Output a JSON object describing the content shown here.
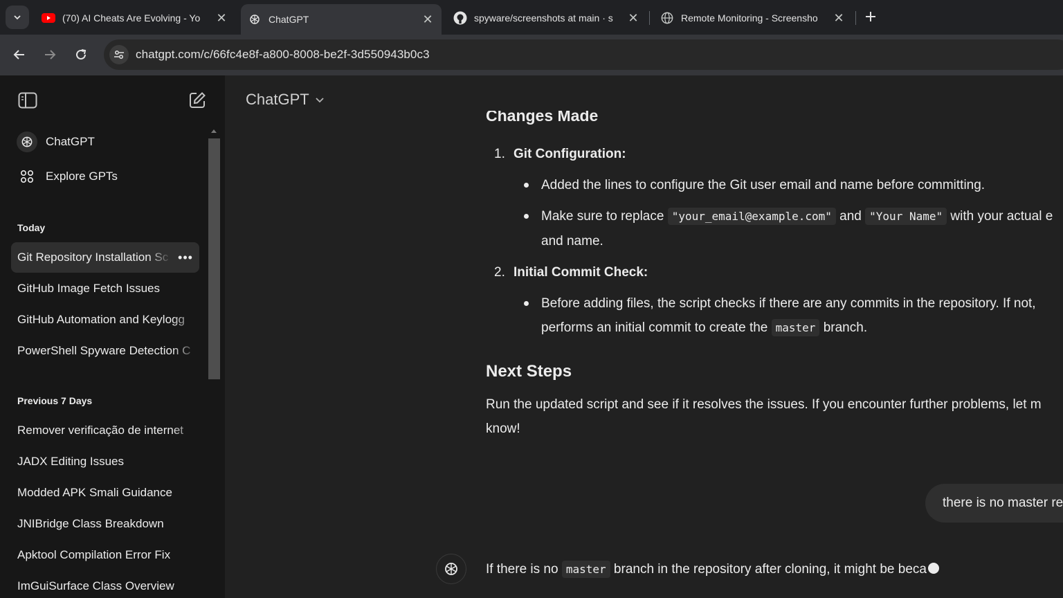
{
  "browser": {
    "tabs": [
      {
        "title": "(70) AI Cheats Are Evolving - Yo",
        "favicon": "youtube-icon",
        "active": false
      },
      {
        "title": "ChatGPT",
        "favicon": "openai-icon",
        "active": true
      },
      {
        "title": "spyware/screenshots at main · s",
        "favicon": "github-icon",
        "active": false
      },
      {
        "title": "Remote Monitoring - Screensho",
        "favicon": "globe-icon",
        "active": false
      }
    ],
    "url": "chatgpt.com/c/66fc4e8f-a800-8008-be2f-3d550943b0c3"
  },
  "sidebar": {
    "nav": [
      {
        "label": "ChatGPT",
        "icon": "openai-icon"
      },
      {
        "label": "Explore GPTs",
        "icon": "grid-icon"
      }
    ],
    "sections": [
      {
        "title": "Today",
        "items": [
          {
            "label": "Git Repository Installation Sc"
          },
          {
            "label": "GitHub Image Fetch Issues"
          },
          {
            "label": "GitHub Automation and Keylogg"
          },
          {
            "label": "PowerShell Spyware Detection C"
          }
        ]
      },
      {
        "title": "Previous 7 Days",
        "items": [
          {
            "label": "Remover verificação de internet"
          },
          {
            "label": "JADX Editing Issues"
          },
          {
            "label": "Modded APK Smali Guidance"
          },
          {
            "label": "JNIBridge Class Breakdown"
          },
          {
            "label": "Apktool Compilation Error Fix"
          },
          {
            "label": "ImGuiSurface Class Overview"
          }
        ]
      }
    ],
    "more_label": "•••"
  },
  "main": {
    "model_title": "ChatGPT",
    "cut_heading": "Changes Made",
    "list": [
      {
        "number": "1.",
        "heading": "Git Configuration:",
        "bullet1": "Added the lines to configure the Git user email and name before committing.",
        "bullet2": {
          "pre": "Make sure to replace",
          "code1": "\"your_email@example.com\"",
          "mid": "and",
          "code2": "\"Your Name\"",
          "post": "with your actual e",
          "cont": "and name."
        }
      },
      {
        "number": "2.",
        "heading": "Initial Commit Check:",
        "bullet1": {
          "line1": "Before adding files, the script checks if there are any commits in the repository. If not,",
          "line2_pre": "performs an initial commit to create the",
          "code": "master",
          "line2_post": "branch."
        }
      }
    ],
    "next_steps_heading": "Next Steps",
    "next_steps_line1": "Run the updated script and see if it resolves the issues. If you encounter further problems, let m",
    "next_steps_line2": "know!",
    "user_message": "there is no master re",
    "assistant_reply": {
      "pre": "If there is no",
      "code": "master",
      "post": "branch in the repository after cloning, it might be beca"
    }
  }
}
